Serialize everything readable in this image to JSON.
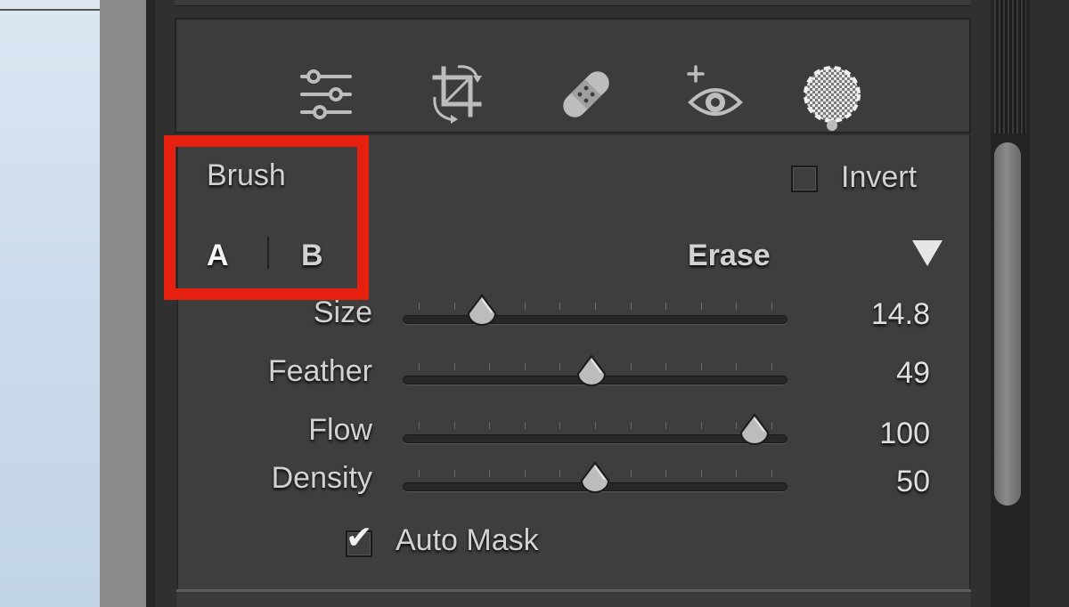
{
  "toolbar": {
    "tools": [
      {
        "name": "edit-sliders-icon"
      },
      {
        "name": "crop-icon"
      },
      {
        "name": "healing-bandage-icon"
      },
      {
        "name": "red-eye-icon"
      },
      {
        "name": "masking-icon"
      }
    ],
    "active_tool": "masking-icon"
  },
  "brush": {
    "title": "Brush",
    "tab_a": "A",
    "tab_b": "B",
    "erase_label": "Erase",
    "invert_label": "Invert",
    "invert_checked": false,
    "sliders": [
      {
        "label": "Size",
        "value_text": "14.8",
        "fraction": 0.18
      },
      {
        "label": "Feather",
        "value_text": "49",
        "fraction": 0.49
      },
      {
        "label": "Flow",
        "value_text": "100",
        "fraction": 0.95
      },
      {
        "label": "Density",
        "value_text": "50",
        "fraction": 0.5
      }
    ],
    "auto_mask_label": "Auto Mask",
    "auto_mask_checked": true
  },
  "colors": {
    "highlight": "#e5200f",
    "panel": "#3e3e3e",
    "text": "#d2d2d2"
  }
}
